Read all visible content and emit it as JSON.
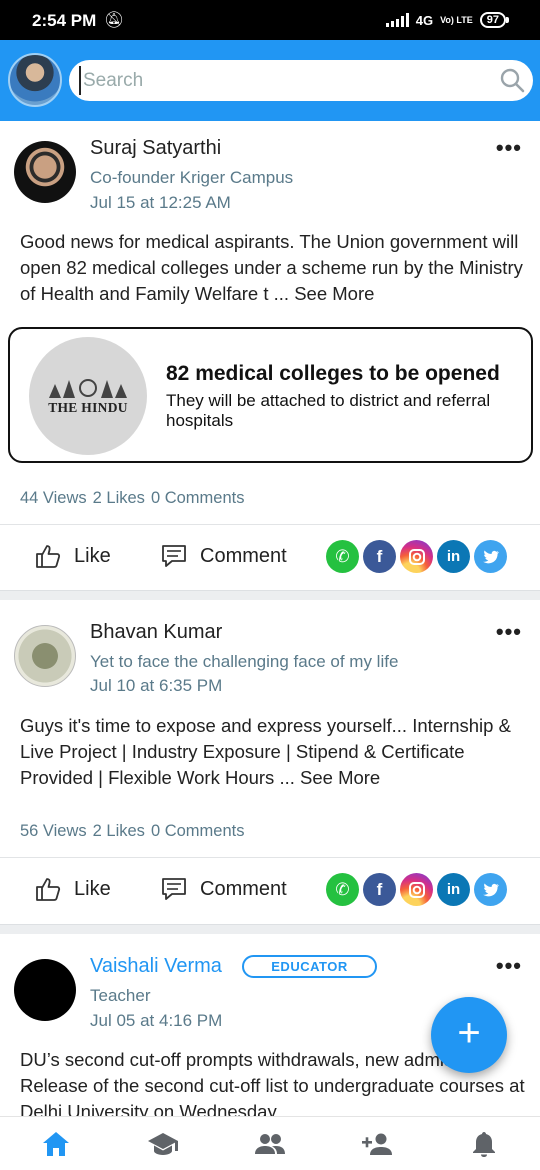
{
  "status_bar": {
    "time": "2:54 PM",
    "network": "4G",
    "volte": "Vo) LTE",
    "battery": "97"
  },
  "header": {
    "search_placeholder": "Search"
  },
  "posts": [
    {
      "author": "Suraj Satyarthi",
      "subtitle": "Co-founder Kriger Campus",
      "date": "Jul 15 at 12:25 AM",
      "body": "Good news for medical aspirants. The Union government will open 82 medical colleges under a scheme run by the Ministry of Health and Family Welfare t ...",
      "see_more": "See More",
      "link": {
        "source_logo": "THE HINDU",
        "title": "82 medical colleges to be opened",
        "description": "They will be attached to district and referral hospitals"
      },
      "views": "44 Views",
      "likes": "2 Likes",
      "comments": "0 Comments"
    },
    {
      "author": "Bhavan Kumar",
      "subtitle": "Yet to face the challenging face of my life",
      "date": "Jul 10 at 6:35 PM",
      "body": "Guys it's time to expose and express yourself... Internship & Live Project | Industry Exposure | Stipend & Certificate Provided | Flexible Work Hours ...",
      "see_more": "See More",
      "views": "56 Views",
      "likes": "2 Likes",
      "comments": "0 Comments"
    },
    {
      "author": "Vaishali Verma",
      "badge": "EDUCATOR",
      "subtitle": "Teacher",
      "date": "Jul 05 at 4:16 PM",
      "body": "DU’s second cut-off prompts withdrawals, new admission. Release of the second cut-off list to undergraduate courses at Delhi University on Wednesday"
    }
  ],
  "actions": {
    "like_label": "Like",
    "comment_label": "Comment",
    "more_label": "•••",
    "share_icons": [
      "whatsapp-icon",
      "facebook-icon",
      "instagram-icon",
      "linkedin-icon",
      "twitter-icon"
    ]
  },
  "bottom_nav": [
    "home-icon",
    "courses-icon",
    "groups-icon",
    "add-friend-icon",
    "notifications-icon"
  ],
  "colors": {
    "primary": "#2196f3",
    "status_bar": "#000000",
    "muted_text": "#5a7a8a"
  }
}
